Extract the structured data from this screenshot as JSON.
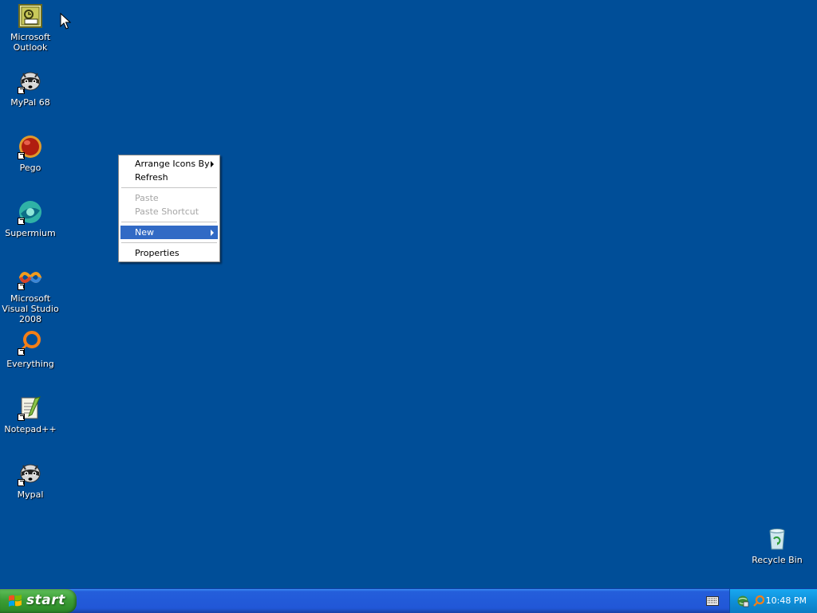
{
  "desktop": {
    "icons": [
      {
        "label": "Microsoft Outlook",
        "icon": "outlook-icon",
        "shortcut": false
      },
      {
        "label": "MyPal 68",
        "icon": "raccoon-icon",
        "shortcut": true
      },
      {
        "label": "Pego",
        "icon": "pego-icon",
        "shortcut": true
      },
      {
        "label": "Supermium",
        "icon": "supermium-icon",
        "shortcut": true
      },
      {
        "label": "Microsoft Visual Studio 2008",
        "icon": "visual-studio-icon",
        "shortcut": true
      },
      {
        "label": "Everything",
        "icon": "everything-icon",
        "shortcut": true
      },
      {
        "label": "Notepad++",
        "icon": "notepadpp-icon",
        "shortcut": true
      },
      {
        "label": "Mypal",
        "icon": "raccoon-icon",
        "shortcut": true
      }
    ],
    "recycle_bin": {
      "label": "Recycle Bin",
      "icon": "recycle-bin-icon"
    }
  },
  "context_menu": {
    "items": [
      {
        "label": "Arrange Icons By",
        "submenu": true,
        "disabled": false
      },
      {
        "label": "Refresh",
        "submenu": false,
        "disabled": false
      },
      {
        "label": "Paste",
        "submenu": false,
        "disabled": true
      },
      {
        "label": "Paste Shortcut",
        "submenu": false,
        "disabled": true
      },
      {
        "label": "New",
        "submenu": true,
        "disabled": false,
        "highlighted": true
      },
      {
        "label": "Properties",
        "submenu": false,
        "disabled": false
      }
    ]
  },
  "taskbar": {
    "start_label": "start",
    "clock": "10:48 PM",
    "tray_icons": [
      "network-icon",
      "search-icon"
    ],
    "keyboard_icon": "keyboard-icon"
  },
  "colors": {
    "desktop": "#004e98",
    "taskbar": "#245edb",
    "start": "#3c9e36",
    "menu_highlight": "#316ac5",
    "tray": "#0f8fd9"
  }
}
